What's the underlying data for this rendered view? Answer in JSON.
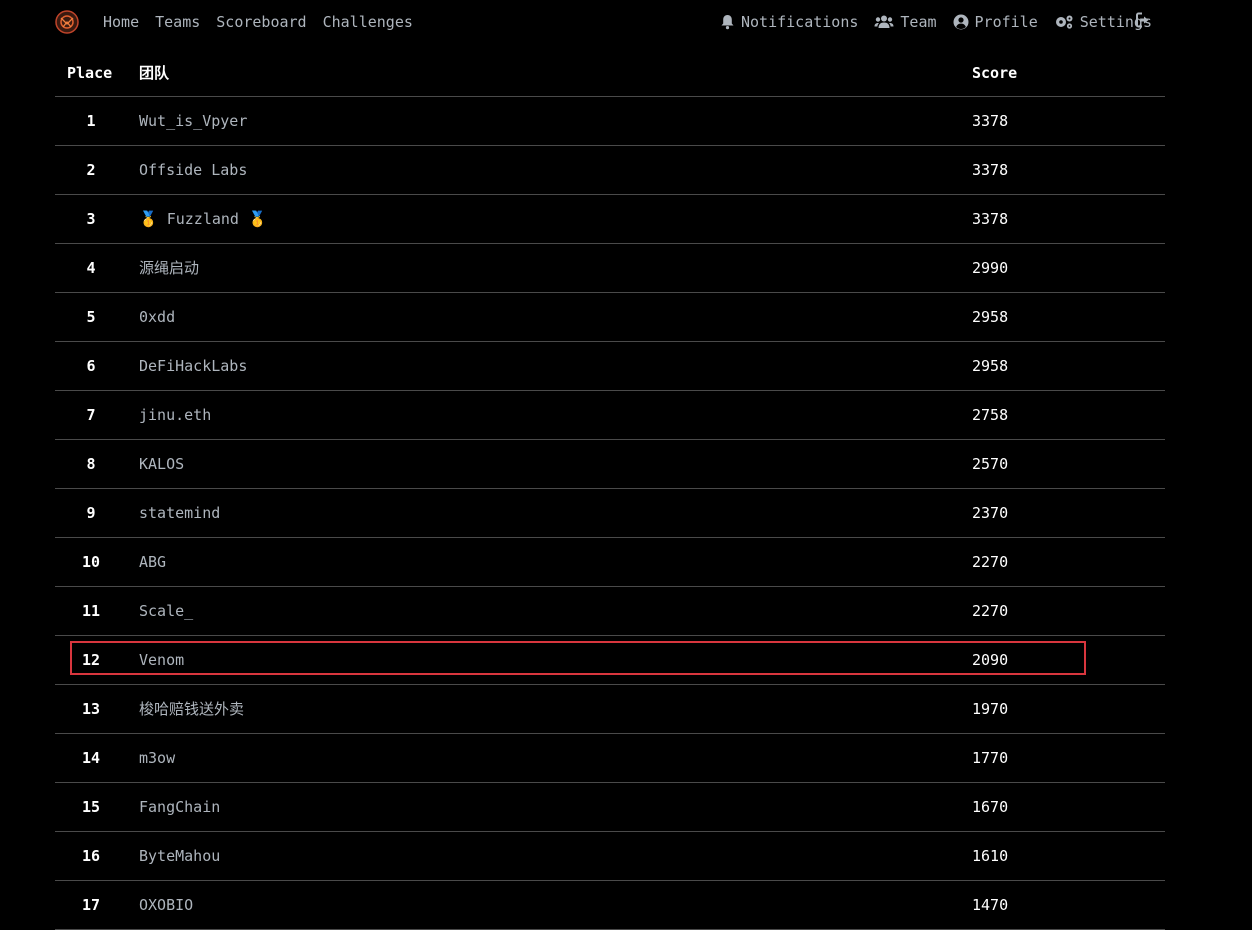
{
  "nav": {
    "left": [
      "Home",
      "Teams",
      "Scoreboard",
      "Challenges"
    ],
    "notifications": "Notifications",
    "team": "Team",
    "profile": "Profile",
    "settings": "Settings"
  },
  "table": {
    "headers": {
      "place": "Place",
      "team": "团队",
      "score": "Score"
    },
    "rows": [
      {
        "place": "1",
        "team": "Wut_is_Vpyer",
        "score": "3378"
      },
      {
        "place": "2",
        "team": "Offside Labs",
        "score": "3378"
      },
      {
        "place": "3",
        "team": "🥇 Fuzzland 🥇",
        "score": "3378"
      },
      {
        "place": "4",
        "team": "源绳启动",
        "score": "2990"
      },
      {
        "place": "5",
        "team": "0xdd",
        "score": "2958"
      },
      {
        "place": "6",
        "team": "DeFiHackLabs",
        "score": "2958"
      },
      {
        "place": "7",
        "team": "jinu.eth",
        "score": "2758"
      },
      {
        "place": "8",
        "team": "KALOS",
        "score": "2570"
      },
      {
        "place": "9",
        "team": "statemind",
        "score": "2370"
      },
      {
        "place": "10",
        "team": "ABG",
        "score": "2270"
      },
      {
        "place": "11",
        "team": "Scale_",
        "score": "2270"
      },
      {
        "place": "12",
        "team": "Venom",
        "score": "2090"
      },
      {
        "place": "13",
        "team": "梭哈赔钱送外卖",
        "score": "1970"
      },
      {
        "place": "14",
        "team": "m3ow",
        "score": "1770"
      },
      {
        "place": "15",
        "team": "FangChain",
        "score": "1670"
      },
      {
        "place": "16",
        "team": "ByteMahou",
        "score": "1610"
      },
      {
        "place": "17",
        "team": "OXOBIO",
        "score": "1470"
      }
    ]
  },
  "highlight": {
    "color": "#d9363e"
  },
  "colors": {
    "background": "#000000",
    "nav_text": "#aeb5bd",
    "header_text": "#ffffff"
  }
}
